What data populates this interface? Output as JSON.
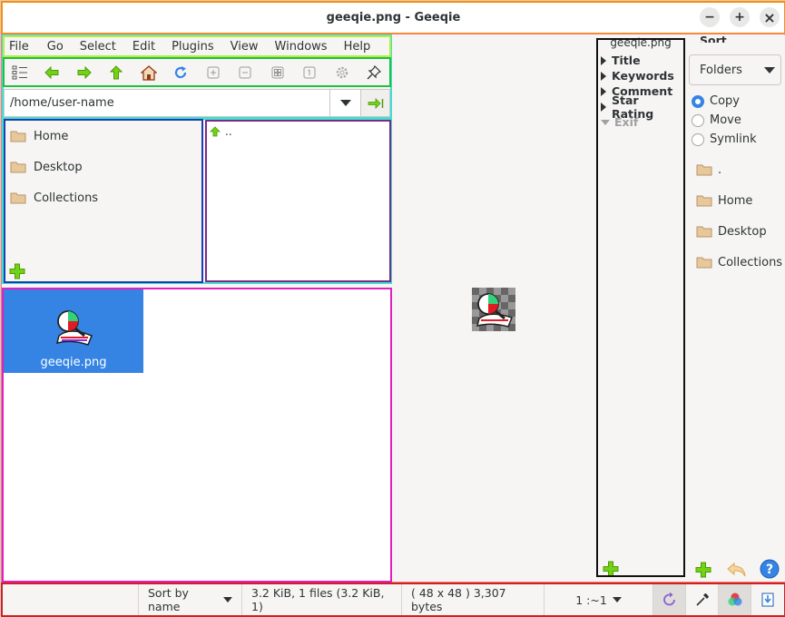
{
  "window": {
    "title": "geeqie.png - Geeqie",
    "minimize": "−",
    "maximize": "+",
    "close": "×"
  },
  "menubar": [
    "File",
    "Go",
    "Select",
    "Edit",
    "Plugins",
    "View",
    "Windows",
    "Help"
  ],
  "toolbar": [
    "list-view-icon",
    "back-arrow-icon",
    "forward-arrow-icon",
    "up-arrow-icon",
    "home-icon",
    "refresh-icon",
    "zoom-in-icon",
    "zoom-out-icon",
    "zoom-fit-icon",
    "zoom-1-1-icon",
    "settings-gear-icon",
    "pin-icon"
  ],
  "path": {
    "value": "/home/user-name"
  },
  "bookmarks": {
    "items": [
      "Home",
      "Desktop",
      "Collections"
    ]
  },
  "dirlist": {
    "up": ".."
  },
  "files": [
    {
      "name": "geeqie.png"
    }
  ],
  "metadata": {
    "filename": "geeqie.png",
    "sections": [
      "Title",
      "Keywords",
      "Comment",
      "Star Rating"
    ],
    "exif": "Exif"
  },
  "sort_manager": {
    "title": "Sort Manager",
    "mode": "Folders",
    "actions": [
      "Copy",
      "Move",
      "Symlink"
    ],
    "selected_action": "Copy",
    "folders": [
      ".",
      "Home",
      "Desktop",
      "Collections"
    ]
  },
  "status": {
    "sort": "Sort by name",
    "files": "3.2 KiB, 1 files (3.2 KiB, 1)",
    "image": "( 48 x 48 ) 3,307 bytes",
    "zoom": "1 :~1"
  },
  "colors": {
    "accent": "#3584e4",
    "green": "#4e9a06",
    "folder": "#e8c89a"
  }
}
